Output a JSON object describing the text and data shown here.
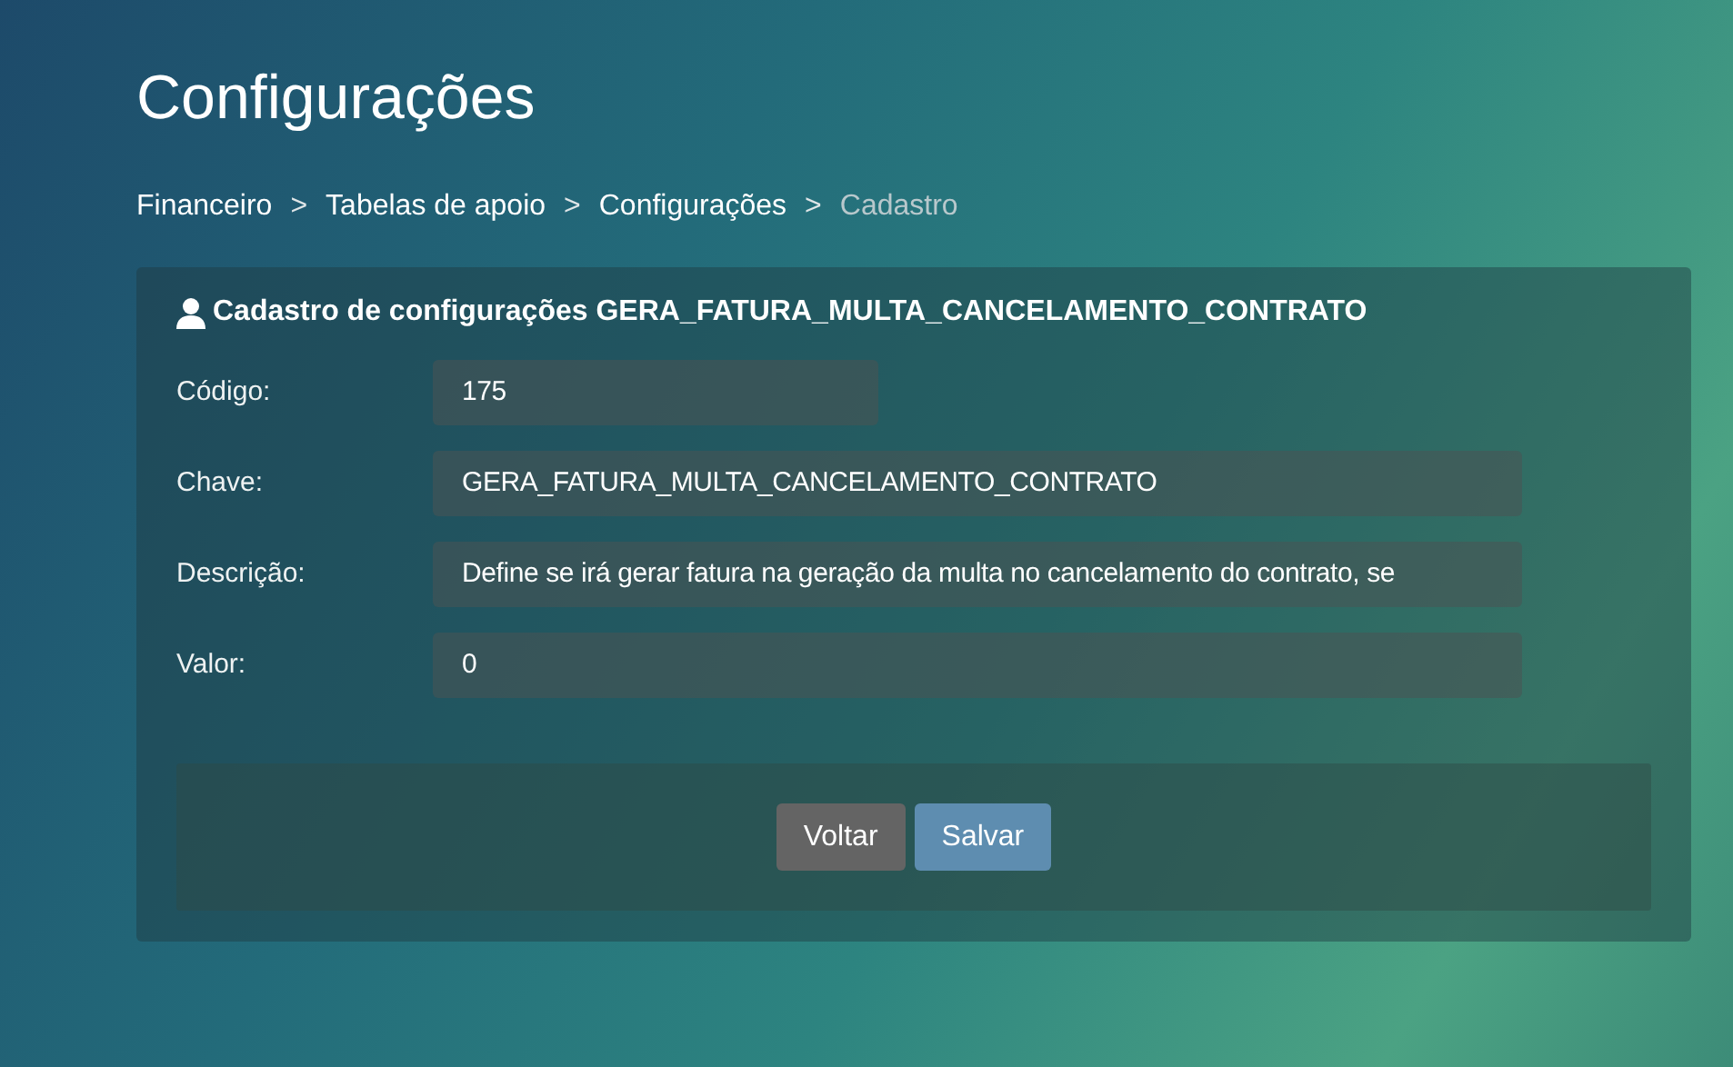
{
  "page_title": "Configurações",
  "breadcrumb": {
    "separator": ">",
    "items": [
      {
        "label": "Financeiro",
        "current": false
      },
      {
        "label": "Tabelas de apoio",
        "current": false
      },
      {
        "label": "Configurações",
        "current": false
      },
      {
        "label": "Cadastro",
        "current": true
      }
    ]
  },
  "form": {
    "title": "Cadastro de configurações GERA_FATURA_MULTA_CANCELAMENTO_CONTRATO",
    "fields": [
      {
        "label": "Código:",
        "value": "175",
        "kind": "short"
      },
      {
        "label": "Chave:",
        "value": "GERA_FATURA_MULTA_CANCELAMENTO_CONTRATO",
        "kind": "wide"
      },
      {
        "label": "Descrição:",
        "value": "Define se irá gerar fatura na geração da multa no cancelamento do contrato, se",
        "kind": "wide"
      },
      {
        "label": "Valor:",
        "value": "0",
        "kind": "wide"
      }
    ],
    "buttons": [
      {
        "label": "Voltar",
        "kind": "secondary"
      },
      {
        "label": "Salvar",
        "kind": "primary"
      }
    ]
  }
}
